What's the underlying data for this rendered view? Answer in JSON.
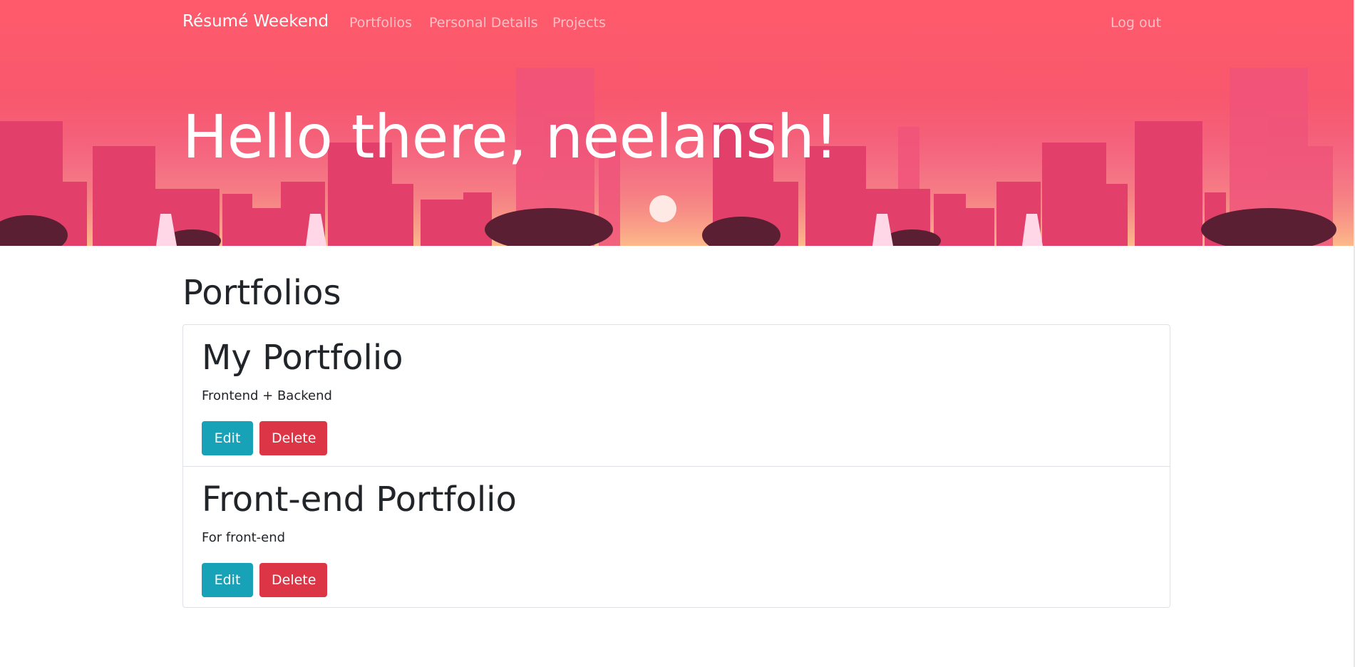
{
  "navbar": {
    "brand": "Résumé Weekend",
    "links": [
      {
        "label": "Portfolios"
      },
      {
        "label": "Personal Details"
      },
      {
        "label": "Projects"
      }
    ],
    "logout_label": "Log out"
  },
  "hero": {
    "greeting": "Hello there, neelansh!"
  },
  "main": {
    "section_title": "Portfolios",
    "portfolios": [
      {
        "title": "My Portfolio",
        "description": "Frontend + Backend",
        "edit_label": "Edit",
        "delete_label": "Delete"
      },
      {
        "title": "Front-end Portfolio",
        "description": "For front-end",
        "edit_label": "Edit",
        "delete_label": "Delete"
      }
    ]
  },
  "colors": {
    "hero_background": "#f8586d",
    "edit_button": "#17a2b8",
    "delete_button": "#dc3545",
    "text": "#212529"
  }
}
